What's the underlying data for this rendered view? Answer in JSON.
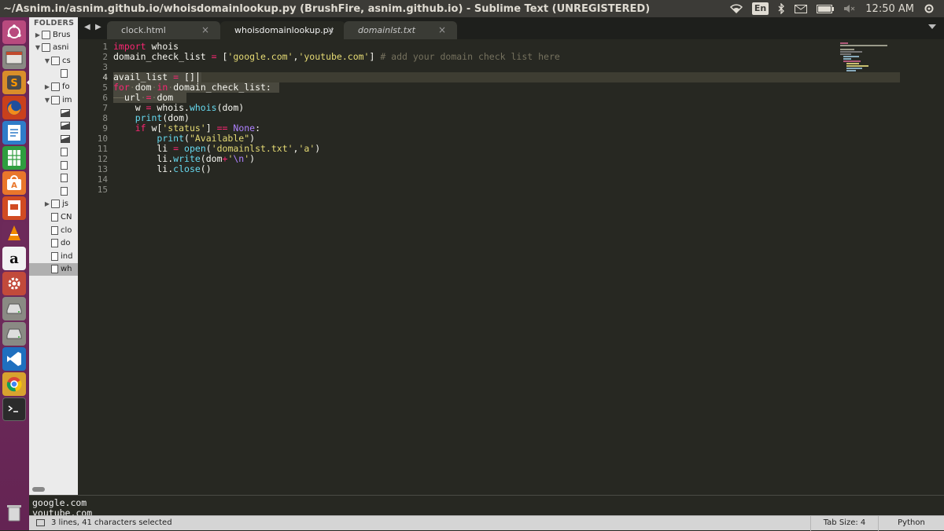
{
  "window": {
    "title": "~/Asnim.in/asnim.github.io/whoisdomainlookup.py (BrushFire, asnim.github.io) - Sublime Text (UNREGISTERED)"
  },
  "system_tray": {
    "language": "En",
    "time": "12:50 AM",
    "icons": [
      "wifi-icon",
      "bluetooth-icon",
      "mail-icon",
      "battery-icon",
      "volume-muted-icon",
      "power-gear-icon"
    ]
  },
  "launcher": {
    "apps": [
      "ubuntu-dash-icon",
      "files-icon",
      "sublime-text-icon",
      "firefox-icon",
      "libreoffice-writer-icon",
      "libreoffice-calc-icon",
      "software-center-icon",
      "libreoffice-impress-icon",
      "vlc-icon",
      "amazon-icon",
      "system-settings-icon",
      "drive-icon",
      "drive-icon",
      "vscode-icon",
      "chrome-icon",
      "terminal-icon",
      "trash-icon"
    ],
    "amazon_glyph": "a"
  },
  "sidebar": {
    "heading": "FOLDERS",
    "items": [
      {
        "label": "Brus",
        "type": "folder",
        "expanded": false
      },
      {
        "label": "asni",
        "type": "folder",
        "expanded": true
      },
      {
        "label": "cs",
        "type": "folder",
        "expanded": true
      },
      {
        "label": "",
        "type": "file"
      },
      {
        "label": "fo",
        "type": "folder",
        "expanded": false
      },
      {
        "label": "im",
        "type": "folder",
        "expanded": true
      },
      {
        "label": "",
        "type": "image"
      },
      {
        "label": "",
        "type": "image"
      },
      {
        "label": "",
        "type": "image"
      },
      {
        "label": "",
        "type": "file"
      },
      {
        "label": "",
        "type": "file"
      },
      {
        "label": "",
        "type": "file"
      },
      {
        "label": "",
        "type": "file"
      },
      {
        "label": "js",
        "type": "folder",
        "expanded": false
      },
      {
        "label": "CN",
        "type": "file"
      },
      {
        "label": "clo",
        "type": "file"
      },
      {
        "label": "do",
        "type": "file"
      },
      {
        "label": "ind",
        "type": "file"
      },
      {
        "label": "wh",
        "type": "file",
        "selected": true
      }
    ]
  },
  "tabs": [
    {
      "label": "clock.html",
      "active": false,
      "italic": false
    },
    {
      "label": "whoisdomainlookup.py",
      "active": true,
      "italic": false
    },
    {
      "label": "domainlst.txt",
      "active": false,
      "italic": true
    }
  ],
  "editor": {
    "line_numbers": [
      "1",
      "2",
      "3",
      "4",
      "5",
      "6",
      "7",
      "8",
      "9",
      "10",
      "11",
      "12",
      "13",
      "14",
      "15"
    ]
  },
  "output_panel": {
    "lines": [
      "google.com",
      "youtube.com"
    ]
  },
  "status_bar": {
    "selection": "3 lines, 41 characters selected",
    "tab_size": "Tab Size: 4",
    "syntax": "Python"
  },
  "colors": {
    "editor_bg": "#272822",
    "keyword": "#f92672",
    "string": "#e6db74",
    "comment": "#75715e",
    "function": "#66d9ef",
    "constant": "#ae81ff",
    "launcher_bg": "#6a2757"
  }
}
